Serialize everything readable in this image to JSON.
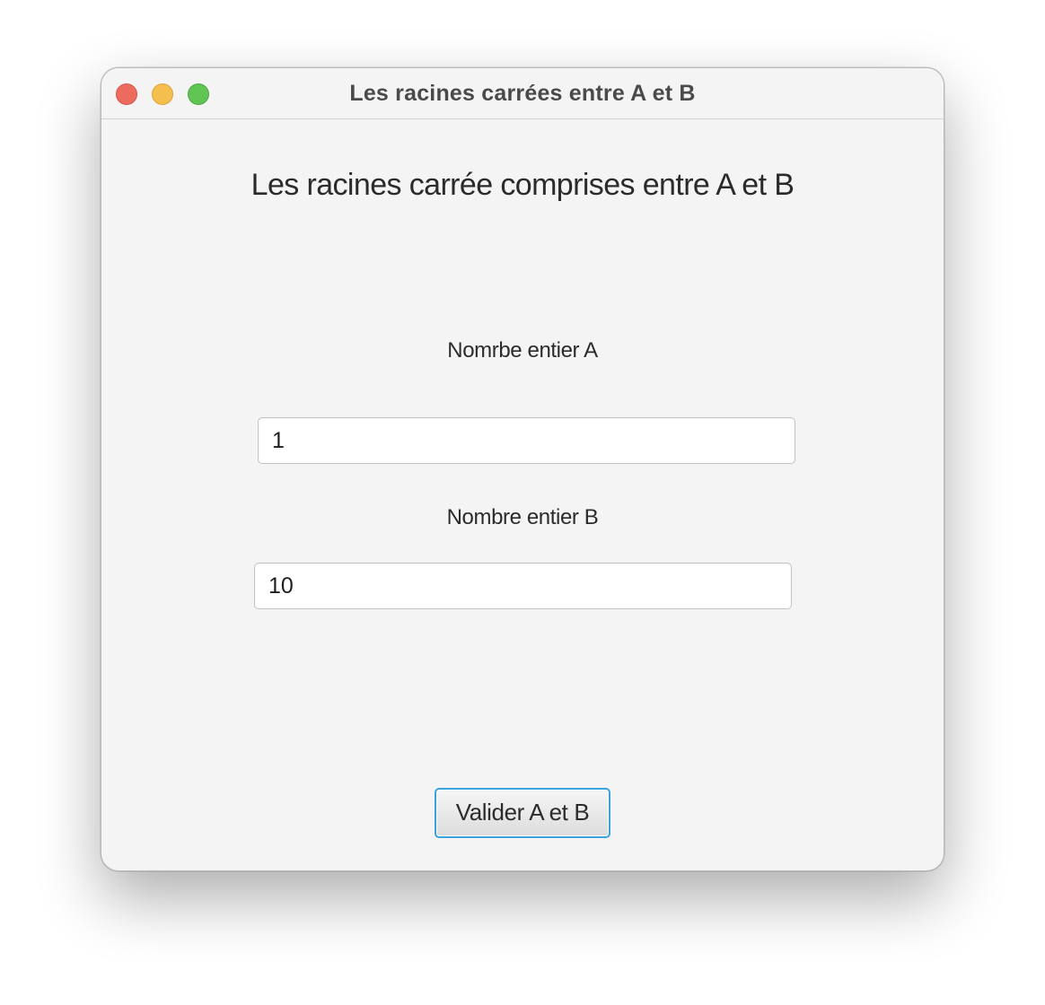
{
  "window": {
    "title": "Les racines carrées entre A et B",
    "controls": {
      "close_color": "#ed6a5e",
      "minimize_color": "#f5bf4f",
      "maximize_color": "#61c554"
    }
  },
  "main": {
    "heading": "Les racines carrée comprises entre A et B",
    "field_a": {
      "label": "Nomrbe entier A",
      "value": "1"
    },
    "field_b": {
      "label": "Nombre entier B",
      "value": "10"
    },
    "submit_label": "Valider A et B",
    "focus_color": "#3aa3df"
  }
}
